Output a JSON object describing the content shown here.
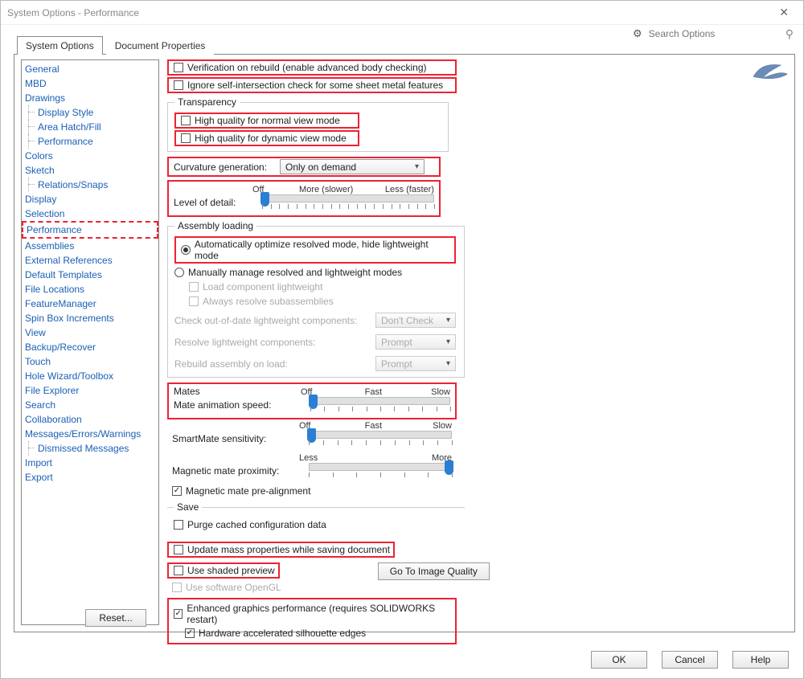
{
  "window": {
    "title": "System Options - Performance"
  },
  "search": {
    "placeholder": "Search Options"
  },
  "tabs": {
    "system": "System Options",
    "document": "Document Properties"
  },
  "tree": {
    "items": [
      {
        "label": "General",
        "level": 1
      },
      {
        "label": "MBD",
        "level": 1
      },
      {
        "label": "Drawings",
        "level": 1
      },
      {
        "label": "Display Style",
        "level": 2
      },
      {
        "label": "Area Hatch/Fill",
        "level": 2
      },
      {
        "label": "Performance",
        "level": 2
      },
      {
        "label": "Colors",
        "level": 1
      },
      {
        "label": "Sketch",
        "level": 1
      },
      {
        "label": "Relations/Snaps",
        "level": 2
      },
      {
        "label": "Display",
        "level": 1
      },
      {
        "label": "Selection",
        "level": 1
      },
      {
        "label": "Performance",
        "level": 1,
        "selected": true
      },
      {
        "label": "Assemblies",
        "level": 1
      },
      {
        "label": "External References",
        "level": 1
      },
      {
        "label": "Default Templates",
        "level": 1
      },
      {
        "label": "File Locations",
        "level": 1
      },
      {
        "label": "FeatureManager",
        "level": 1
      },
      {
        "label": "Spin Box Increments",
        "level": 1
      },
      {
        "label": "View",
        "level": 1
      },
      {
        "label": "Backup/Recover",
        "level": 1
      },
      {
        "label": "Touch",
        "level": 1
      },
      {
        "label": "Hole Wizard/Toolbox",
        "level": 1
      },
      {
        "label": "File Explorer",
        "level": 1
      },
      {
        "label": "Search",
        "level": 1
      },
      {
        "label": "Collaboration",
        "level": 1
      },
      {
        "label": "Messages/Errors/Warnings",
        "level": 1
      },
      {
        "label": "Dismissed Messages",
        "level": 2
      },
      {
        "label": "Import",
        "level": 1
      },
      {
        "label": "Export",
        "level": 1
      }
    ]
  },
  "opts": {
    "verification": "Verification on rebuild (enable advanced body checking)",
    "ignore_self_intersection": "Ignore self-intersection check for some sheet metal features",
    "transparency_legend": "Transparency",
    "trans_normal": "High quality for normal view mode",
    "trans_dynamic": "High quality for dynamic view mode",
    "curvature_label": "Curvature generation:",
    "curvature_value": "Only on demand",
    "lod_label": "Level of detail:",
    "lod_off": "Off",
    "lod_more": "More (slower)",
    "lod_less": "Less (faster)",
    "assembly_loading_legend": "Assembly loading",
    "auto_optimize": "Automatically optimize resolved mode, hide lightweight mode",
    "manual_modes": "Manually manage resolved and lightweight modes",
    "load_lightweight": "Load component lightweight",
    "always_resolve": "Always resolve subassemblies",
    "check_ood_label": "Check out-of-date lightweight components:",
    "check_ood_value": "Don't Check",
    "resolve_lw_label": "Resolve lightweight components:",
    "resolve_lw_value": "Prompt",
    "rebuild_load_label": "Rebuild assembly on load:",
    "rebuild_load_value": "Prompt",
    "mates_legend": "Mates",
    "mate_anim_label": "Mate animation speed:",
    "fast": "Fast",
    "slow": "Slow",
    "off": "Off",
    "smartmate_label": "SmartMate sensitivity:",
    "magmate_label": "Magnetic mate proximity:",
    "less": "Less",
    "more": "More",
    "magmate_prealign": "Magnetic mate pre-alignment",
    "save_legend": "Save",
    "purge_cached": "Purge cached configuration data",
    "update_mass": "Update mass properties while saving document",
    "use_shaded": "Use shaded preview",
    "use_opengl": "Use software OpenGL",
    "goto_image_quality": "Go To Image Quality",
    "enhanced_graphics": "Enhanced graphics performance (requires SOLIDWORKS restart)",
    "hw_silhouette": "Hardware accelerated silhouette edges"
  },
  "buttons": {
    "reset": "Reset...",
    "ok": "OK",
    "cancel": "Cancel",
    "help": "Help"
  }
}
